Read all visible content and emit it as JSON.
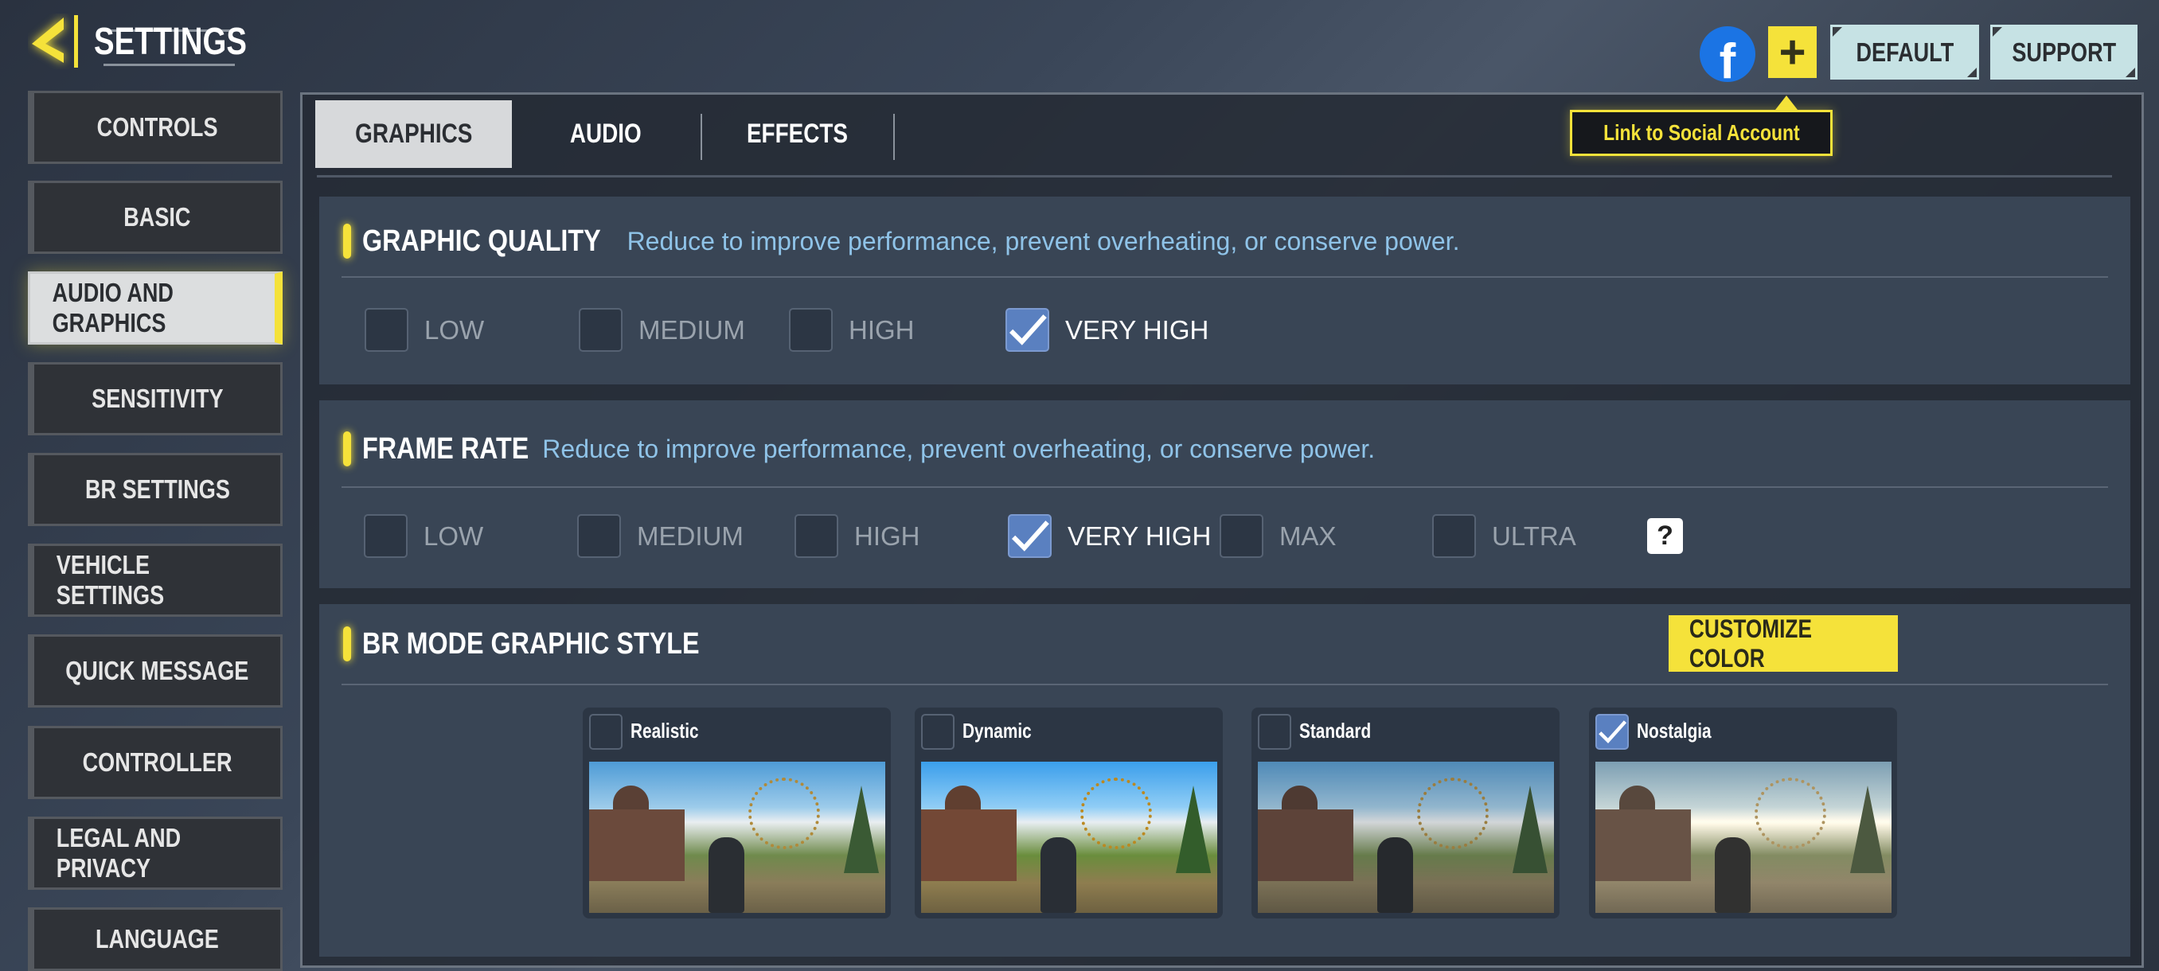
{
  "header": {
    "title": "SETTINGS",
    "back_icon": "back-arrow-icon"
  },
  "sidebar": {
    "items": [
      {
        "label": "CONTROLS"
      },
      {
        "label": "BASIC"
      },
      {
        "label": "AUDIO AND GRAPHICS",
        "active": true
      },
      {
        "label": "SENSITIVITY"
      },
      {
        "label": "BR SETTINGS"
      },
      {
        "label": "VEHICLE SETTINGS"
      },
      {
        "label": "QUICK MESSAGE"
      },
      {
        "label": "CONTROLLER"
      },
      {
        "label": "LEGAL AND PRIVACY"
      },
      {
        "label": "LANGUAGE"
      }
    ]
  },
  "topbar": {
    "default_label": "DEFAULT",
    "support_label": "SUPPORT",
    "tooltip": "Link to Social Account",
    "facebook_icon": "f",
    "plus_icon": "+"
  },
  "tabs": [
    {
      "label": "GRAPHICS",
      "active": true
    },
    {
      "label": "AUDIO"
    },
    {
      "label": "EFFECTS"
    }
  ],
  "graphic_quality": {
    "title": "GRAPHIC QUALITY",
    "description": "Reduce to improve performance, prevent overheating, or conserve power.",
    "options": [
      {
        "label": "LOW"
      },
      {
        "label": "MEDIUM"
      },
      {
        "label": "HIGH"
      },
      {
        "label": "VERY HIGH",
        "checked": true
      }
    ]
  },
  "frame_rate": {
    "title": "FRAME RATE",
    "description": "Reduce to improve performance, prevent overheating, or conserve power.",
    "options": [
      {
        "label": "LOW"
      },
      {
        "label": "MEDIUM"
      },
      {
        "label": "HIGH"
      },
      {
        "label": "VERY HIGH",
        "checked": true
      },
      {
        "label": "MAX"
      },
      {
        "label": "ULTRA"
      }
    ],
    "help": "?"
  },
  "br_style": {
    "title": "BR MODE GRAPHIC STYLE",
    "customize_label": "CUSTOMIZE COLOR",
    "styles": [
      {
        "label": "Realistic"
      },
      {
        "label": "Dynamic"
      },
      {
        "label": "Standard"
      },
      {
        "label": "Nostalgia",
        "checked": true
      }
    ]
  },
  "colors": {
    "accent": "#f5e23a",
    "checkbox_on": "#5a80c0",
    "description": "#8fc3e8"
  }
}
